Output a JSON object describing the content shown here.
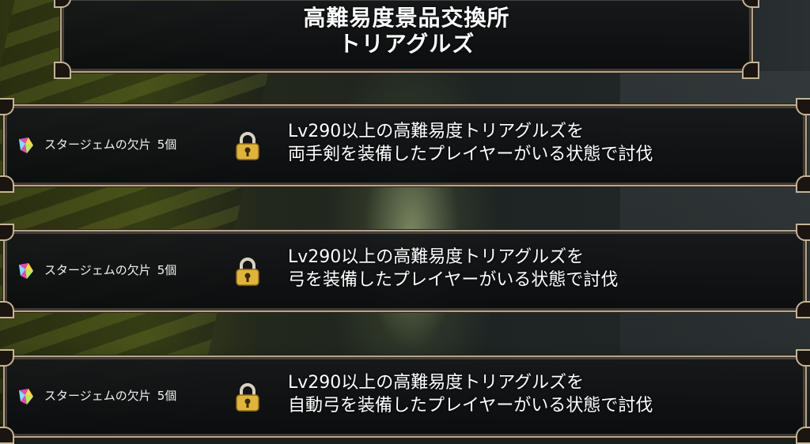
{
  "header": {
    "title_line1": "高難易度景品交換所",
    "title_line2": "トリアグルズ"
  },
  "rewards": [
    {
      "icon": "gem-shard-icon",
      "item": "スタージェムの欠片",
      "qty": "5個",
      "locked": true,
      "condition_line1": "Lv290以上の高難易度トリアグルズを",
      "condition_line2": "両手剣を装備したプレイヤーがいる状態で討伐"
    },
    {
      "icon": "gem-shard-icon",
      "item": "スタージェムの欠片",
      "qty": "5個",
      "locked": true,
      "condition_line1": "Lv290以上の高難易度トリアグルズを",
      "condition_line2": "弓を装備したプレイヤーがいる状態で討伐"
    },
    {
      "icon": "gem-shard-icon",
      "item": "スタージェムの欠片",
      "qty": "5個",
      "locked": true,
      "condition_line1": "Lv290以上の高難易度トリアグルズを",
      "condition_line2": "自動弓を装備したプレイヤーがいる状態で討伐"
    }
  ],
  "colors": {
    "frame": "#b8a58a",
    "panel": "#14171a",
    "text": "#ffffff",
    "lock_gold": "#e0b43c"
  }
}
